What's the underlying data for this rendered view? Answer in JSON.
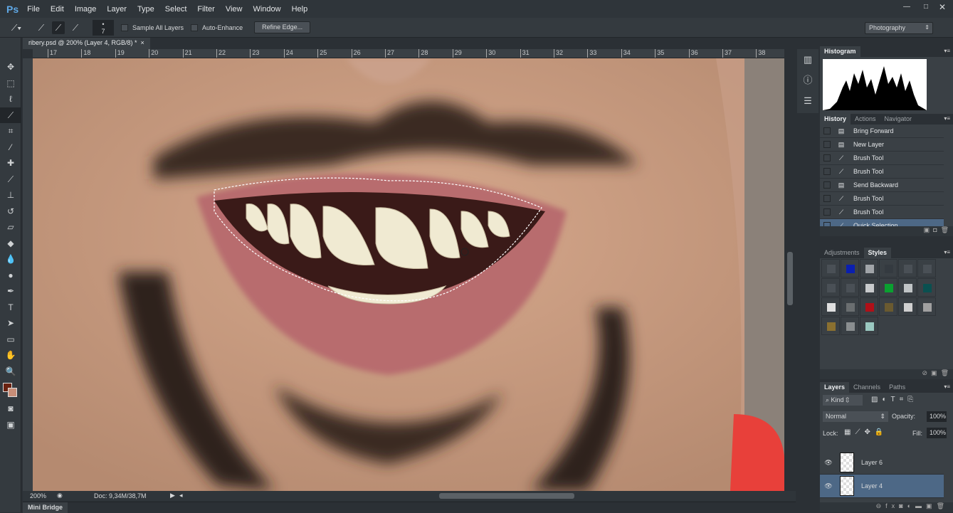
{
  "app": {
    "logo": "Ps",
    "menus": [
      "File",
      "Edit",
      "Image",
      "Layer",
      "Type",
      "Select",
      "Filter",
      "View",
      "Window",
      "Help"
    ],
    "workspace": "Photography"
  },
  "options": {
    "brush_size": "7",
    "sample_all_layers": "Sample All Layers",
    "auto_enhance": "Auto-Enhance",
    "refine_edge": "Refine Edge..."
  },
  "document": {
    "tab_title": "ribery.psd @ 200% (Layer 4, RGB/8) *",
    "close": "×",
    "ruler_numbers": [
      "17",
      "18",
      "19",
      "20",
      "21",
      "22",
      "23",
      "24",
      "25",
      "26",
      "27",
      "28",
      "29",
      "30",
      "31",
      "32",
      "33",
      "34",
      "35",
      "36",
      "37",
      "38"
    ]
  },
  "status": {
    "zoom": "200%",
    "doc": "Doc: 9,34M/38,7M"
  },
  "minibridge": {
    "label": "Mini Bridge"
  },
  "histogram": {
    "tab": "Histogram"
  },
  "history": {
    "tabs": [
      "History",
      "Actions",
      "Navigator"
    ],
    "items": [
      {
        "label": "Bring Forward",
        "icon": "doc-icon"
      },
      {
        "label": "New Layer",
        "icon": "doc-icon"
      },
      {
        "label": "Brush Tool",
        "icon": "brush-icon"
      },
      {
        "label": "Brush Tool",
        "icon": "brush-icon"
      },
      {
        "label": "Send Backward",
        "icon": "doc-icon"
      },
      {
        "label": "Brush Tool",
        "icon": "brush-icon"
      },
      {
        "label": "Brush Tool",
        "icon": "brush-icon"
      },
      {
        "label": "Quick Selection",
        "icon": "quick-selection-icon",
        "selected": true
      }
    ]
  },
  "styles": {
    "tabs": [
      "Adjustments",
      "Styles"
    ],
    "swatches": [
      "#4a5056",
      "#0a1fb0",
      "#a0a4a8",
      "#343a40",
      "#4a5056",
      "#4a5056",
      "#4a5056",
      "#4a5056",
      "#c8cacc",
      "#0aa030",
      "#c0c4c6",
      "#0a5050",
      "#e0e0e0",
      "#6a6e70",
      "#b01018",
      "#6a5a30",
      "#d0d0d0",
      "#a0a0a0",
      "#8a7030",
      "#8a8e90",
      "#9ac8c0"
    ]
  },
  "layers": {
    "tabs": [
      "Layers",
      "Channels",
      "Paths"
    ],
    "kind": "Kind",
    "blend_mode": "Normal",
    "opacity_label": "Opacity:",
    "opacity": "100%",
    "lock_label": "Lock:",
    "fill_label": "Fill:",
    "fill": "100%",
    "items": [
      {
        "name": "Layer 6"
      },
      {
        "name": "Layer 4",
        "selected": true
      }
    ]
  }
}
